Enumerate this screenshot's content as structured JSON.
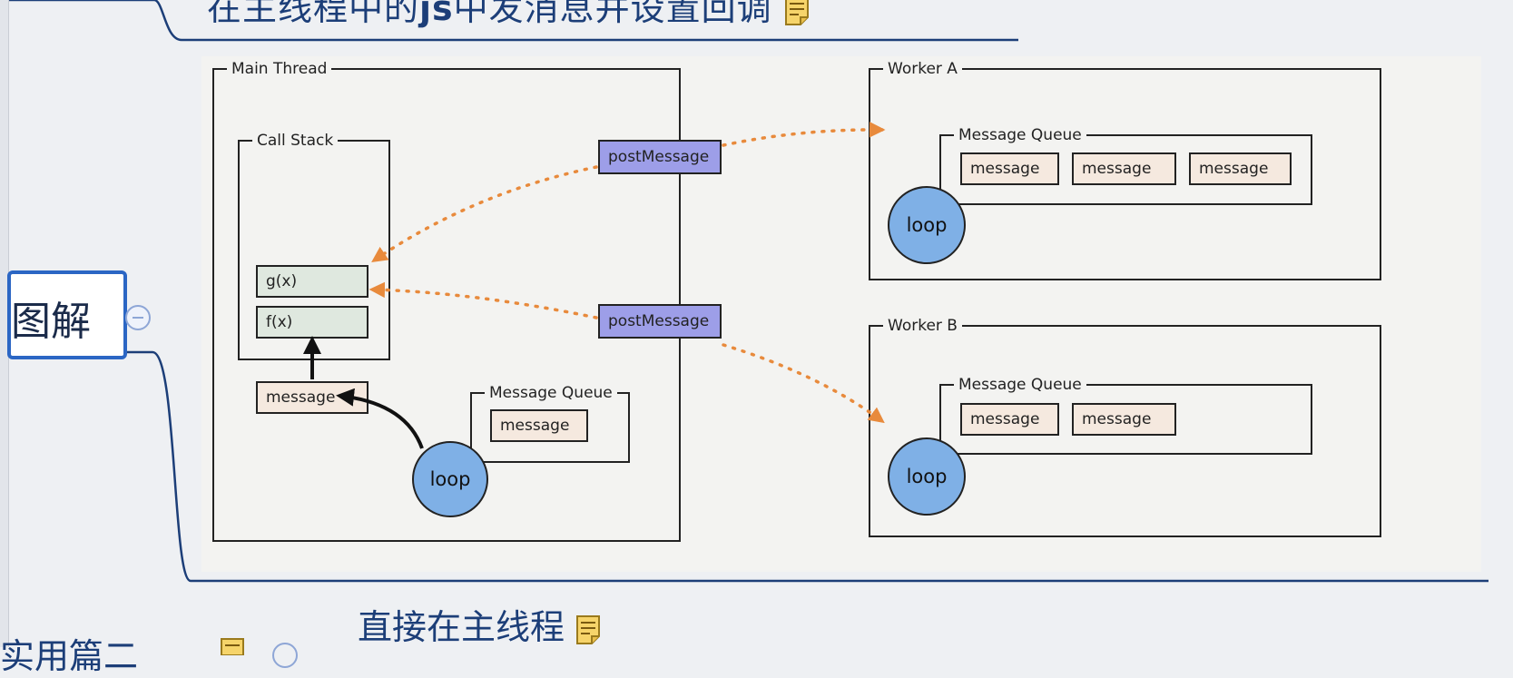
{
  "mindmap": {
    "top_node": {
      "text_before": "在主线程中的",
      "text_js": "js",
      "text_after": "中发消息并设置回调"
    },
    "center_node": {
      "label": "图解"
    },
    "bottom_node": {
      "label": "直接在主线程"
    },
    "partial_node": {
      "label": "实用篇二"
    }
  },
  "diagram": {
    "main_thread": {
      "title": "Main Thread",
      "call_stack": {
        "title": "Call Stack",
        "frames": [
          "g(x)",
          "f(x)"
        ]
      },
      "current_message": "message",
      "message_queue": {
        "title": "Message Queue",
        "items": [
          "message"
        ]
      },
      "loop_label": "loop"
    },
    "post_buttons": [
      "postMessage",
      "postMessage"
    ],
    "worker_a": {
      "title": "Worker A",
      "message_queue": {
        "title": "Message Queue",
        "items": [
          "message",
          "message",
          "message"
        ]
      },
      "loop_label": "loop"
    },
    "worker_b": {
      "title": "Worker B",
      "message_queue": {
        "title": "Message Queue",
        "items": [
          "message",
          "message"
        ]
      },
      "loop_label": "loop"
    }
  },
  "colors": {
    "mindmap_text": "#1c3e78",
    "node_border": "#2b66c4",
    "arrow_orange": "#e88a3c",
    "post_message_fill": "#9d9ee8",
    "loop_fill": "#7fb0e6",
    "message_fill": "#f5e9df",
    "stack_fill": "#dfe8df"
  },
  "icons": [
    "note-icon",
    "collapse-icon"
  ]
}
